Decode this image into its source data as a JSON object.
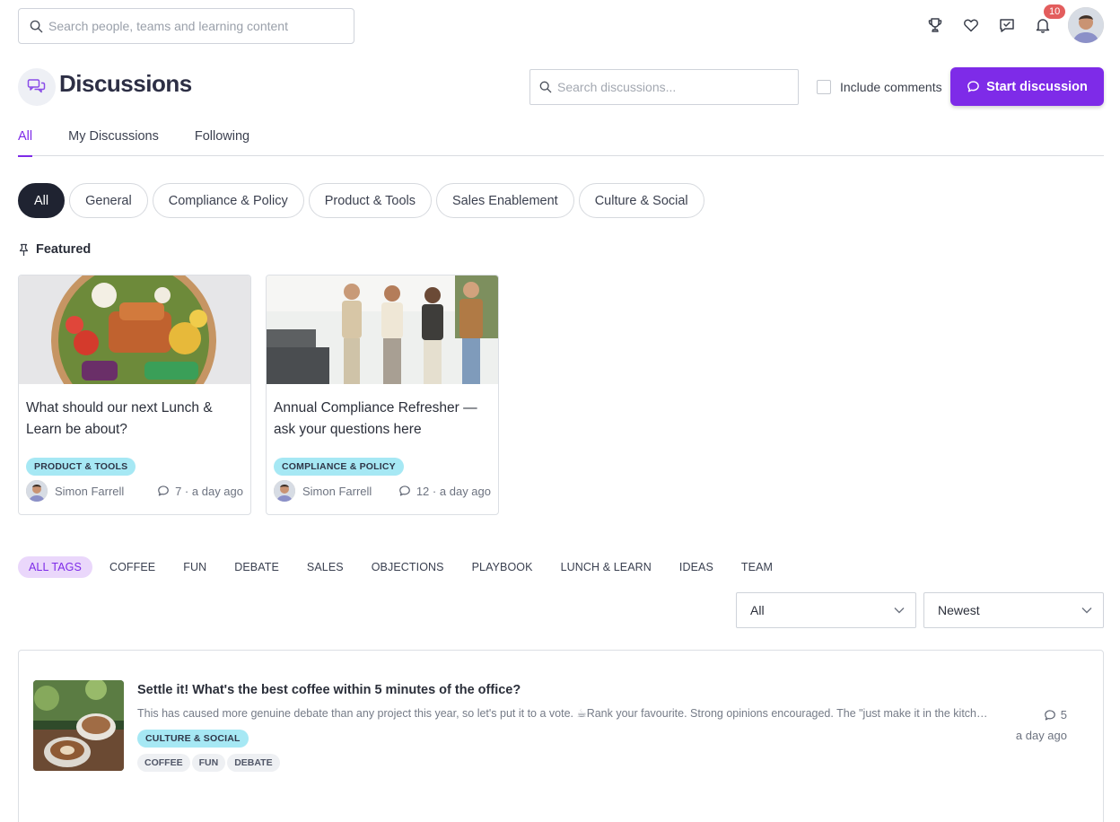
{
  "topbar": {
    "search_placeholder": "Search people, teams and learning content",
    "notifications_count": "10"
  },
  "header": {
    "title": "Discussions",
    "search_placeholder": "Search discussions...",
    "include_comments_label": "Include comments",
    "start_button_label": "Start discussion"
  },
  "tabs": [
    "All",
    "My Discussions",
    "Following"
  ],
  "categories": [
    "All",
    "General",
    "Compliance & Policy",
    "Product & Tools",
    "Sales Enablement",
    "Culture & Social"
  ],
  "featured": {
    "label": "Featured",
    "cards": [
      {
        "title": "What should our next Lunch & Learn be about?",
        "category": "PRODUCT & TOOLS",
        "author": "Simon Farrell",
        "comments": "7",
        "separator": "·",
        "time": "a day ago"
      },
      {
        "title": "Annual Compliance Refresher — ask your questions here",
        "category": "COMPLIANCE & POLICY",
        "author": "Simon Farrell",
        "comments": "12",
        "separator": "·",
        "time": "a day ago"
      }
    ]
  },
  "tag_filters": [
    "ALL TAGS",
    "COFFEE",
    "FUN",
    "DEBATE",
    "SALES",
    "OBJECTIONS",
    "PLAYBOOK",
    "LUNCH & LEARN",
    "IDEAS",
    "TEAM"
  ],
  "filters": {
    "scope_value": "All",
    "sort_value": "Newest"
  },
  "list": [
    {
      "title": "Settle it! What's the best coffee within 5 minutes of the office?",
      "excerpt": "This has caused more genuine debate than any project this year, so let's put it to a vote. ☕Rank your favourite. Strong opinions encouraged. The \"just make it in the kitchen\" crowd can also weigh in.",
      "category": "CULTURE & SOCIAL",
      "tags": [
        "COFFEE",
        "FUN",
        "DEBATE"
      ],
      "comments": "5",
      "time": "a day ago"
    }
  ],
  "colors": {
    "accent": "#7e2be8",
    "chip": "#a6e8f4",
    "active_pill": "#1f2331",
    "badge": "#e35d5d"
  }
}
